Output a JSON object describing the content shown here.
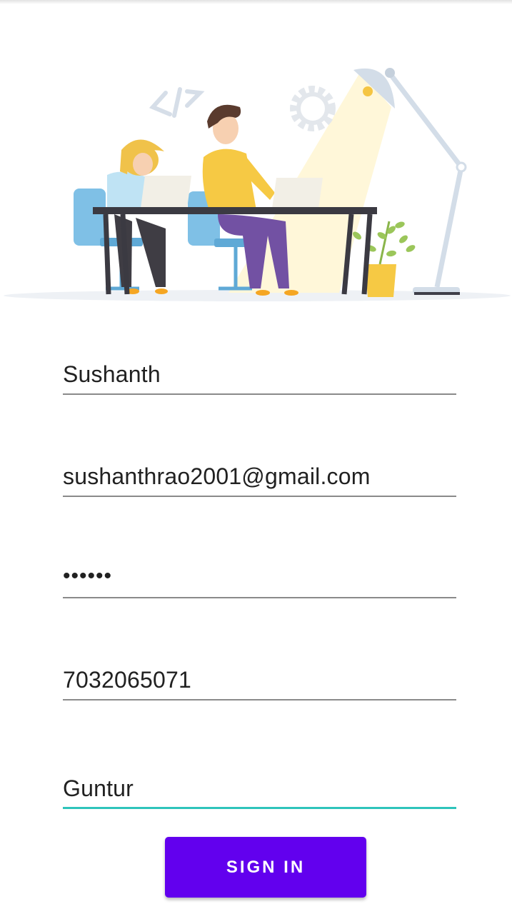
{
  "form": {
    "name_value": "Sushanth",
    "email_value": "sushanthrao2001@gmail.com",
    "password_value": "••••••",
    "phone_value": "7032065071",
    "city_value": "Guntur"
  },
  "button": {
    "label": "SIGN IN"
  },
  "colors": {
    "accent": "#6200ee",
    "focus_underline": "#2ec4bb"
  },
  "icons": [
    "code-icon",
    "gear-icon"
  ]
}
